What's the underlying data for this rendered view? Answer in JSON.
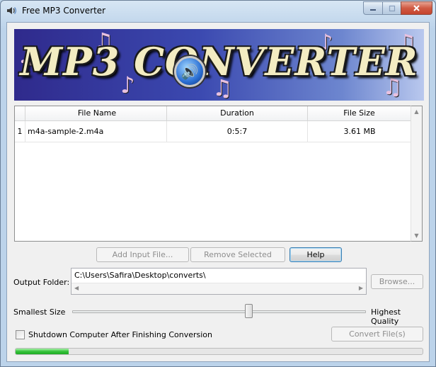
{
  "window": {
    "title": "Free MP3 Converter"
  },
  "banner": {
    "title": "MP3 CONVERTER"
  },
  "table": {
    "columns": [
      "File Name",
      "Duration",
      "File Size"
    ],
    "rows": [
      {
        "index": "1",
        "file_name": "m4a-sample-2.m4a",
        "duration": "0:5:7",
        "file_size": "3.61 MB"
      }
    ]
  },
  "buttons": {
    "add_input_file": "Add Input File...",
    "remove_selected": "Remove Selected",
    "help": "Help",
    "browse": "Browse...",
    "convert_files": "Convert File(s)"
  },
  "output": {
    "label": "Output Folder:",
    "path": "C:\\Users\\Safira\\Desktop\\converts\\"
  },
  "quality": {
    "min_label": "Smallest Size",
    "max_label": "Highest Quality",
    "level": 0.6
  },
  "shutdown": {
    "label": "Shutdown Computer After Finishing Conversion",
    "checked": false
  },
  "progress": {
    "fraction": 0.13
  },
  "colors": {
    "progress_fill": "#35c23a",
    "banner_left": "#2f2a8c",
    "close_button": "#c5442d"
  }
}
